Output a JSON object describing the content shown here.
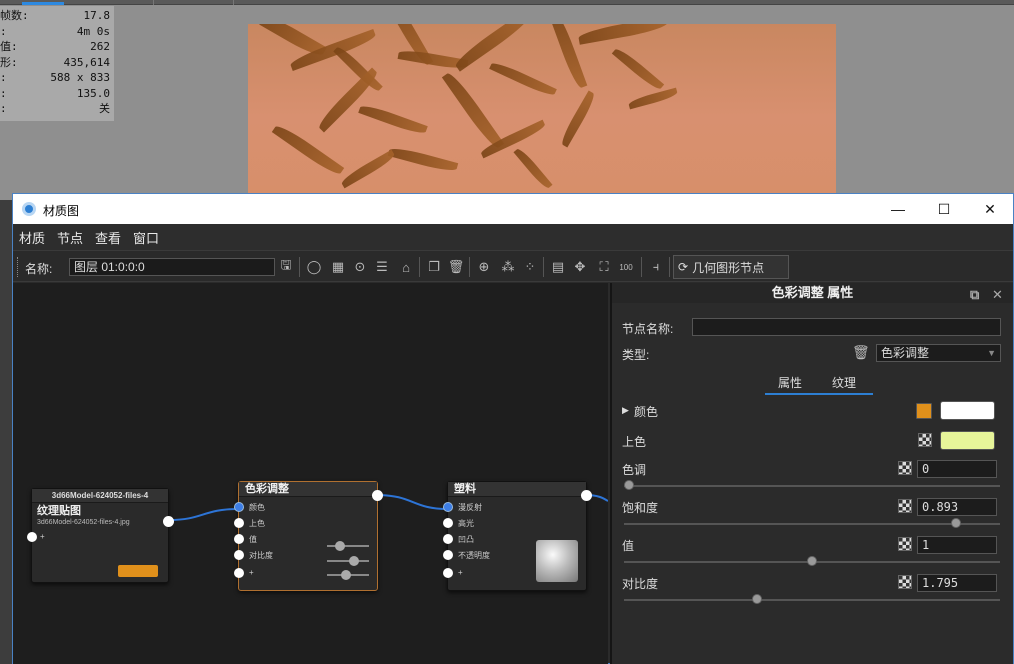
{
  "stats": [
    {
      "label": "帧数:",
      "value": "17.8"
    },
    {
      "label": ":",
      "value": "4m 0s"
    },
    {
      "label": "值:",
      "value": "262"
    },
    {
      "label": "形:",
      "value": "435,614"
    },
    {
      "label": ":",
      "value": "588 x 833"
    },
    {
      "label": ":",
      "value": "135.0"
    },
    {
      "label": ":",
      "value": "关"
    }
  ],
  "window": {
    "title": "材质图",
    "minimize": "—",
    "maximize": "☐",
    "close": "✕"
  },
  "menu": [
    "材质",
    "节点",
    "查看",
    "窗口"
  ],
  "toolbar": {
    "name_label": "名称:",
    "name_value": "图层 01:0:0:0",
    "geometry_node_button": "几何图形节点"
  },
  "nodes": {
    "texture": {
      "header": "3d66Model-624052-files-4",
      "title": "纹理贴图",
      "filename": "3d66Model-624052-files-4.jpg",
      "port_label": "+"
    },
    "color_adjust": {
      "title": "色彩调整",
      "ports": [
        "颜色",
        "上色",
        "值",
        "对比度",
        "+"
      ]
    },
    "material": {
      "title": "塑料",
      "ports": [
        "漫反射",
        "高光",
        "凹凸",
        "不透明度",
        "+"
      ]
    }
  },
  "panel": {
    "title": "色彩调整 属性",
    "node_name_label": "节点名称:",
    "node_name_value": "",
    "type_label": "类型:",
    "type_value": "色彩调整",
    "tabs": [
      "属性",
      "纹理"
    ],
    "active_tab": "属性",
    "color_label": "颜色",
    "color_accent": "#e0901b",
    "color_value": "#ffffff",
    "tint_label": "上色",
    "tint_value": "#e7f59a",
    "hue_label": "色调",
    "hue_value": "0",
    "hue_level": 0.0,
    "saturation_label": "饱和度",
    "saturation_value": "0.893",
    "saturation_level": 0.893,
    "value_label": "值",
    "value_value": "1",
    "value_level": 0.5,
    "contrast_label": "对比度",
    "contrast_value": "1.795",
    "contrast_level": 0.35
  }
}
